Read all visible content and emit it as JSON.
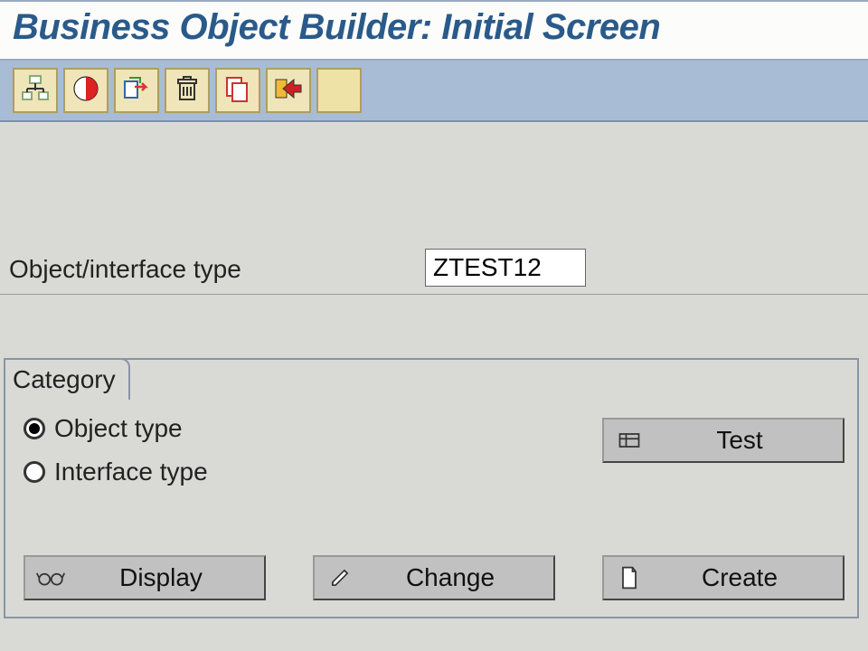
{
  "title": "Business Object Builder: Initial Screen",
  "toolbar": {
    "icons": [
      "subtype-icon",
      "red-circle-icon",
      "export-icon",
      "delete-icon",
      "copy-icon",
      "forward-icon",
      "blank"
    ]
  },
  "field": {
    "label": "Object/interface type",
    "value": "ZTEST12"
  },
  "category": {
    "title": "Category",
    "options": [
      {
        "label": "Object type",
        "selected": true
      },
      {
        "label": "Interface type",
        "selected": false
      }
    ]
  },
  "buttons": {
    "test": "Test",
    "display": "Display",
    "change": "Change",
    "create": "Create"
  }
}
